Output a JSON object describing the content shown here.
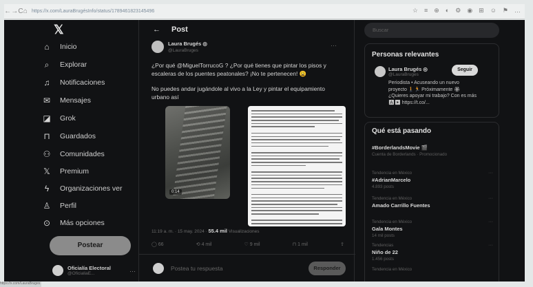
{
  "browser": {
    "url": "https://x.com/LauraBrugésInfo/status/1789461823145496",
    "nav_icons": [
      "←",
      "→",
      "C",
      "⌂"
    ],
    "ext_icons": [
      "☆",
      "≡",
      "⊕",
      "◐",
      "⚙",
      "◉",
      "⊞",
      "☺",
      "⚑",
      "…"
    ]
  },
  "sidebar": {
    "logo": "𝕏",
    "items": [
      {
        "icon": "⌂",
        "label": "Inicio"
      },
      {
        "icon": "⌕",
        "label": "Explorar"
      },
      {
        "icon": "♫",
        "label": "Notificaciones"
      },
      {
        "icon": "✉",
        "label": "Mensajes"
      },
      {
        "icon": "◪",
        "label": "Grok"
      },
      {
        "icon": "⊓",
        "label": "Guardados"
      },
      {
        "icon": "⚇",
        "label": "Comunidades"
      },
      {
        "icon": "𝕏",
        "label": "Premium"
      },
      {
        "icon": "ϟ",
        "label": "Organizaciones ver"
      },
      {
        "icon": "♙",
        "label": "Perfil"
      },
      {
        "icon": "⊙",
        "label": "Más opciones"
      }
    ],
    "post_button": "Postear",
    "account": {
      "name": "Oficialía Electoral",
      "handle": "@OficialiaE...",
      "more": "···"
    }
  },
  "center": {
    "back": "←",
    "title": "Post",
    "author": {
      "name": "Laura Brugés ◎",
      "handle": "@LauraBruges",
      "more": "···"
    },
    "text_1": "¿Por qué @MiguelTorrucoG ? ¿Por qué tienes que pintar los pisos y escaleras de los puentes peatonales? ¡No te pertenecen! 😩",
    "text_2": "No puedes andar jugándole al vivo a la Ley y pintar el equipamiento urbano así",
    "video_time": "0:14",
    "meta_time": "11:19 a. m. · 15 may. 2024 · ",
    "meta_views": "55.4 mil",
    "meta_views_label": " Visualizaciones",
    "actions": [
      "◯ 66",
      "⟲ 4 mil",
      "♡ 9 mil",
      "⊓ 1 mil",
      "⇪"
    ],
    "reply_placeholder": "Postea tu respuesta",
    "reply_button": "Responder"
  },
  "right": {
    "search_placeholder": "Buscar",
    "relevant_title": "Personas relevantes",
    "relevant": {
      "name": "Laura Brugés ◎",
      "handle": "@LauraBruges",
      "follow": "Seguir",
      "bio": "Periodista • Acuseando un nuevo proyecto 🚶🏃 Próximamente 🏵 ¿Quieres apoyar mi trabajo? Con es más 🅰▶ https://t.co/..."
    },
    "trends_title": "Qué está pasando",
    "trends": [
      {
        "cat": "",
        "name": "#BorderlandsMovie 🎬",
        "sub": "Cuenta de Borderlands · Promocionado"
      },
      {
        "cat": "Tendencia en México",
        "name": "#AdrianMarcelo",
        "sub": "4.893 posts"
      },
      {
        "cat": "Tendencia en México",
        "name": "Amado Carrillo Fuentes",
        "sub": ""
      },
      {
        "cat": "Tendencia en México",
        "name": "Gala Montes",
        "sub": "14 mil posts"
      },
      {
        "cat": "Tendencias",
        "name": "Niño de 22",
        "sub": "1.456 posts"
      },
      {
        "cat": "Tendencia en México",
        "name": "",
        "sub": ""
      }
    ]
  },
  "status_bar": "https://x.com/LauraBruges"
}
